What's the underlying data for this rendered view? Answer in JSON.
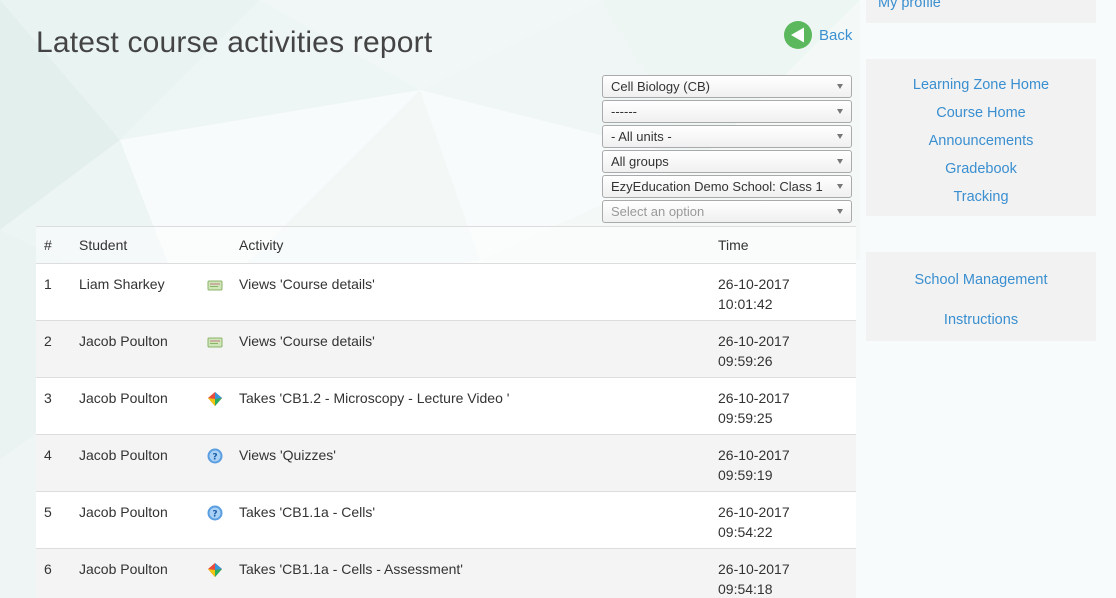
{
  "page": {
    "title": "Latest course activities report",
    "back_label": "Back"
  },
  "filters": [
    {
      "value": "Cell Biology (CB)",
      "placeholder": false
    },
    {
      "value": "------",
      "placeholder": false
    },
    {
      "value": "- All units -",
      "placeholder": false
    },
    {
      "value": "All groups",
      "placeholder": false
    },
    {
      "value": "EzyEducation Demo School: Class 1",
      "placeholder": false
    },
    {
      "value": "Select an option",
      "placeholder": true
    }
  ],
  "table": {
    "headers": [
      "#",
      "Student",
      "",
      "Activity",
      "Time"
    ],
    "rows": [
      {
        "num": "1",
        "student": "Liam Sharkey",
        "icon": "course-details-icon",
        "activity": "Views 'Course details'",
        "date": "26-10-2017",
        "time": "10:01:42"
      },
      {
        "num": "2",
        "student": "Jacob Poulton",
        "icon": "course-details-icon",
        "activity": "Views 'Course details'",
        "date": "26-10-2017",
        "time": "09:59:26"
      },
      {
        "num": "3",
        "student": "Jacob Poulton",
        "icon": "lecture-video-icon",
        "activity": "Takes 'CB1.2 - Microscopy - Lecture Video '",
        "date": "26-10-2017",
        "time": "09:59:25"
      },
      {
        "num": "4",
        "student": "Jacob Poulton",
        "icon": "quiz-icon",
        "activity": "Views 'Quizzes'",
        "date": "26-10-2017",
        "time": "09:59:19"
      },
      {
        "num": "5",
        "student": "Jacob Poulton",
        "icon": "quiz-icon",
        "activity": "Takes 'CB1.1a - Cells'",
        "date": "26-10-2017",
        "time": "09:54:22"
      },
      {
        "num": "6",
        "student": "Jacob Poulton",
        "icon": "lecture-video-icon",
        "activity": "Takes 'CB1.1a - Cells - Assessment'",
        "date": "26-10-2017",
        "time": "09:54:18"
      }
    ]
  },
  "sidebar": {
    "profile_link": "My profile",
    "nav": [
      "Learning Zone Home",
      "Course Home",
      "Announcements",
      "Gradebook",
      "Tracking"
    ],
    "management": [
      "School Management",
      "Instructions"
    ]
  },
  "colors": {
    "link": "#3a8fd0",
    "back_icon": "#5bb85d",
    "sidebar_bg": "#f2f2f2"
  }
}
